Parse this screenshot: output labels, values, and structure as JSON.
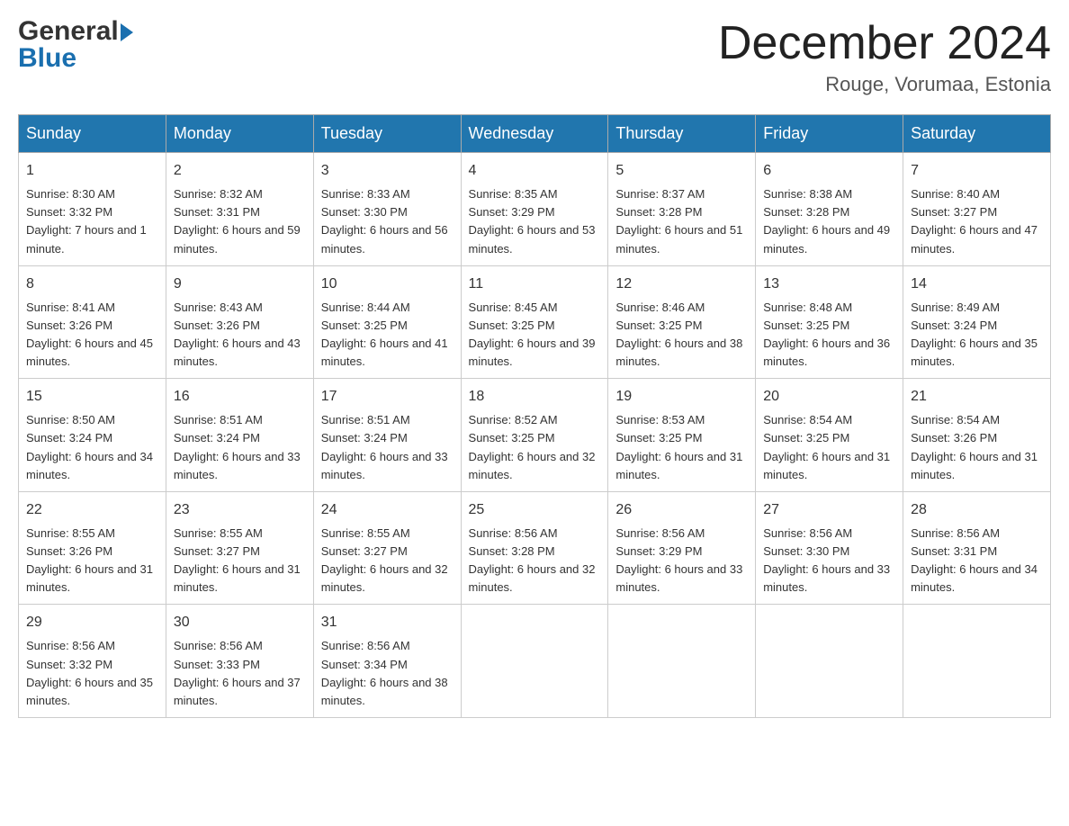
{
  "header": {
    "logo_general": "General",
    "logo_blue": "Blue",
    "month_title": "December 2024",
    "location": "Rouge, Vorumaa, Estonia"
  },
  "weekdays": [
    "Sunday",
    "Monday",
    "Tuesday",
    "Wednesday",
    "Thursday",
    "Friday",
    "Saturday"
  ],
  "weeks": [
    [
      {
        "day": "1",
        "sunrise": "8:30 AM",
        "sunset": "3:32 PM",
        "daylight": "7 hours and 1 minute."
      },
      {
        "day": "2",
        "sunrise": "8:32 AM",
        "sunset": "3:31 PM",
        "daylight": "6 hours and 59 minutes."
      },
      {
        "day": "3",
        "sunrise": "8:33 AM",
        "sunset": "3:30 PM",
        "daylight": "6 hours and 56 minutes."
      },
      {
        "day": "4",
        "sunrise": "8:35 AM",
        "sunset": "3:29 PM",
        "daylight": "6 hours and 53 minutes."
      },
      {
        "day": "5",
        "sunrise": "8:37 AM",
        "sunset": "3:28 PM",
        "daylight": "6 hours and 51 minutes."
      },
      {
        "day": "6",
        "sunrise": "8:38 AM",
        "sunset": "3:28 PM",
        "daylight": "6 hours and 49 minutes."
      },
      {
        "day": "7",
        "sunrise": "8:40 AM",
        "sunset": "3:27 PM",
        "daylight": "6 hours and 47 minutes."
      }
    ],
    [
      {
        "day": "8",
        "sunrise": "8:41 AM",
        "sunset": "3:26 PM",
        "daylight": "6 hours and 45 minutes."
      },
      {
        "day": "9",
        "sunrise": "8:43 AM",
        "sunset": "3:26 PM",
        "daylight": "6 hours and 43 minutes."
      },
      {
        "day": "10",
        "sunrise": "8:44 AM",
        "sunset": "3:25 PM",
        "daylight": "6 hours and 41 minutes."
      },
      {
        "day": "11",
        "sunrise": "8:45 AM",
        "sunset": "3:25 PM",
        "daylight": "6 hours and 39 minutes."
      },
      {
        "day": "12",
        "sunrise": "8:46 AM",
        "sunset": "3:25 PM",
        "daylight": "6 hours and 38 minutes."
      },
      {
        "day": "13",
        "sunrise": "8:48 AM",
        "sunset": "3:25 PM",
        "daylight": "6 hours and 36 minutes."
      },
      {
        "day": "14",
        "sunrise": "8:49 AM",
        "sunset": "3:24 PM",
        "daylight": "6 hours and 35 minutes."
      }
    ],
    [
      {
        "day": "15",
        "sunrise": "8:50 AM",
        "sunset": "3:24 PM",
        "daylight": "6 hours and 34 minutes."
      },
      {
        "day": "16",
        "sunrise": "8:51 AM",
        "sunset": "3:24 PM",
        "daylight": "6 hours and 33 minutes."
      },
      {
        "day": "17",
        "sunrise": "8:51 AM",
        "sunset": "3:24 PM",
        "daylight": "6 hours and 33 minutes."
      },
      {
        "day": "18",
        "sunrise": "8:52 AM",
        "sunset": "3:25 PM",
        "daylight": "6 hours and 32 minutes."
      },
      {
        "day": "19",
        "sunrise": "8:53 AM",
        "sunset": "3:25 PM",
        "daylight": "6 hours and 31 minutes."
      },
      {
        "day": "20",
        "sunrise": "8:54 AM",
        "sunset": "3:25 PM",
        "daylight": "6 hours and 31 minutes."
      },
      {
        "day": "21",
        "sunrise": "8:54 AM",
        "sunset": "3:26 PM",
        "daylight": "6 hours and 31 minutes."
      }
    ],
    [
      {
        "day": "22",
        "sunrise": "8:55 AM",
        "sunset": "3:26 PM",
        "daylight": "6 hours and 31 minutes."
      },
      {
        "day": "23",
        "sunrise": "8:55 AM",
        "sunset": "3:27 PM",
        "daylight": "6 hours and 31 minutes."
      },
      {
        "day": "24",
        "sunrise": "8:55 AM",
        "sunset": "3:27 PM",
        "daylight": "6 hours and 32 minutes."
      },
      {
        "day": "25",
        "sunrise": "8:56 AM",
        "sunset": "3:28 PM",
        "daylight": "6 hours and 32 minutes."
      },
      {
        "day": "26",
        "sunrise": "8:56 AM",
        "sunset": "3:29 PM",
        "daylight": "6 hours and 33 minutes."
      },
      {
        "day": "27",
        "sunrise": "8:56 AM",
        "sunset": "3:30 PM",
        "daylight": "6 hours and 33 minutes."
      },
      {
        "day": "28",
        "sunrise": "8:56 AM",
        "sunset": "3:31 PM",
        "daylight": "6 hours and 34 minutes."
      }
    ],
    [
      {
        "day": "29",
        "sunrise": "8:56 AM",
        "sunset": "3:32 PM",
        "daylight": "6 hours and 35 minutes."
      },
      {
        "day": "30",
        "sunrise": "8:56 AM",
        "sunset": "3:33 PM",
        "daylight": "6 hours and 37 minutes."
      },
      {
        "day": "31",
        "sunrise": "8:56 AM",
        "sunset": "3:34 PM",
        "daylight": "6 hours and 38 minutes."
      },
      null,
      null,
      null,
      null
    ]
  ]
}
